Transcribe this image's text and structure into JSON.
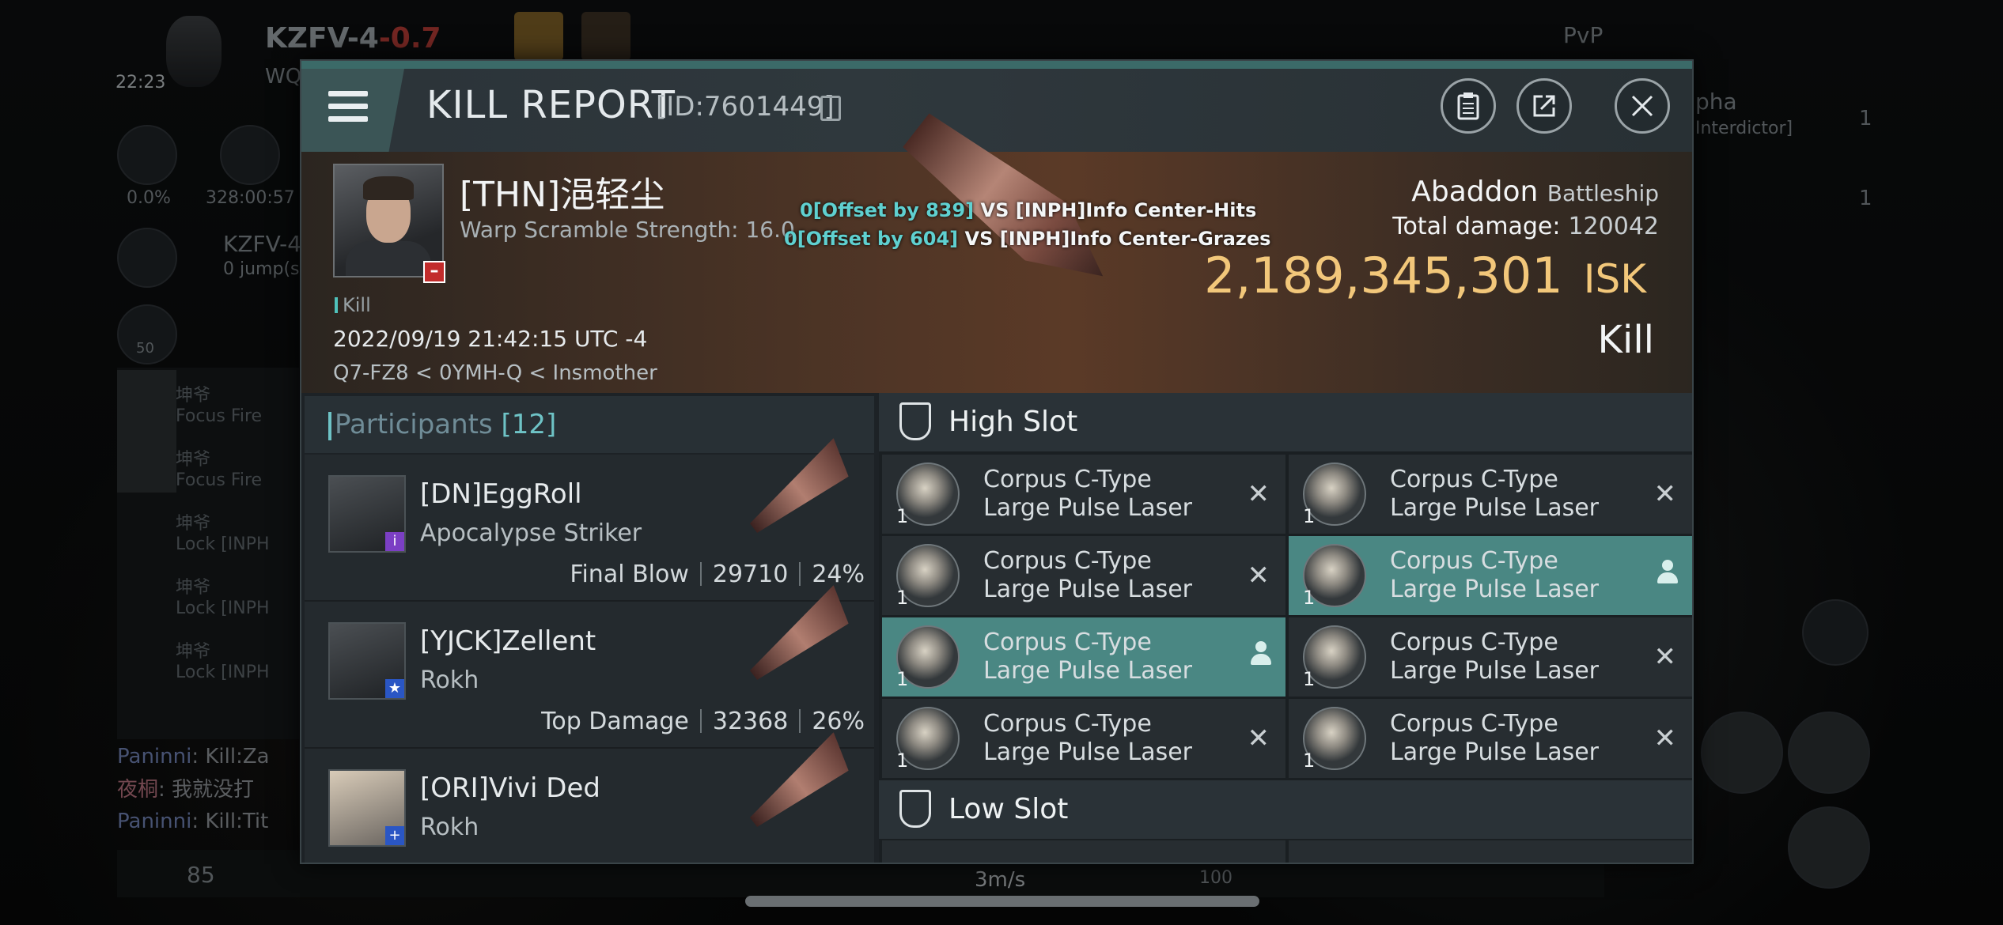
{
  "hud": {
    "system_name": "KZFV-4",
    "security": "-0.7",
    "clock": "22:23",
    "corp_short": "WQ",
    "stat_pct": "0.0%",
    "stat_time": "328:00:57",
    "route_name": "KZFV-4",
    "route_jumps": "0 jump(s",
    "pvp_label": "PvP",
    "count_badge": "50",
    "target_name": "pha",
    "target_class": "Interdictor]",
    "right_count_1": "1",
    "right_count_2": "1",
    "speed": "3m/s",
    "speed_max": "100",
    "local_count": "85",
    "feed": [
      {
        "name": "坤爷",
        "text": "Focus Fire"
      },
      {
        "name": "坤爷",
        "text": "Focus Fire"
      },
      {
        "name": "坤爷",
        "text": "Lock [INPH"
      },
      {
        "name": "坤爷",
        "text": "Lock [INPH"
      },
      {
        "name": "坤爷",
        "text": "Lock [INPH"
      }
    ],
    "chat": [
      {
        "name": "Paninni",
        "text": ": Kill:Za"
      },
      {
        "name": "夜桐",
        "text": ": 我就没打"
      },
      {
        "name": "Paninni",
        "text": ": Kill:Tit"
      }
    ]
  },
  "modal": {
    "title": "KILL REPORT",
    "id": "[ID:7601449]",
    "victim": {
      "name": "[THN]浥轻尘",
      "warp_scramble": "Warp Scramble Strength: 16.0",
      "kill_tag": "Kill",
      "date": "2022/09/19 21:42:15 UTC -4",
      "location": "Q7-FZ8 < 0YMH-Q < Insmother"
    },
    "hits": [
      {
        "value": "0[Offset by 839]",
        "text": "VS [INPH]Info Center-Hits"
      },
      {
        "value": "0[Offset by 604]",
        "text": "VS [INPH]Info Center-Grazes"
      }
    ],
    "ship": {
      "name": "Abaddon",
      "class": "Battleship",
      "total_damage_label": "Total damage:",
      "total_damage": "120042",
      "isk_value": "2,189,345,301",
      "isk_unit": "ISK",
      "result": "Kill"
    },
    "participants": {
      "label": "Participants",
      "count": "[12]",
      "rows": [
        {
          "name": "[DN]EggRoll",
          "ship": "Apocalypse Striker",
          "role": "Final Blow",
          "damage": "29710",
          "pct": "24%"
        },
        {
          "name": "[YJCK]Zellent",
          "ship": "Rokh",
          "role": "Top Damage",
          "damage": "32368",
          "pct": "26%"
        },
        {
          "name": "[ORI]Vivi Ded",
          "ship": "Rokh",
          "role": "",
          "damage": "",
          "pct": ""
        }
      ]
    },
    "high_slot": {
      "label": "High Slot",
      "items": [
        {
          "name": "Corpus C-Type Large Pulse Laser",
          "qty": "1",
          "state": "destroyed"
        },
        {
          "name": "Corpus C-Type Large Pulse Laser",
          "qty": "1",
          "state": "destroyed"
        },
        {
          "name": "Corpus C-Type Large Pulse Laser",
          "qty": "1",
          "state": "destroyed"
        },
        {
          "name": "Corpus C-Type Large Pulse Laser",
          "qty": "1",
          "state": "dropped"
        },
        {
          "name": "Corpus C-Type Large Pulse Laser",
          "qty": "1",
          "state": "dropped"
        },
        {
          "name": "Corpus C-Type Large Pulse Laser",
          "qty": "1",
          "state": "destroyed"
        },
        {
          "name": "Corpus C-Type Large Pulse Laser",
          "qty": "1",
          "state": "destroyed"
        },
        {
          "name": "Corpus C-Type Large Pulse Laser",
          "qty": "1",
          "state": "destroyed"
        }
      ]
    },
    "low_slot": {
      "label": "Low Slot"
    }
  }
}
